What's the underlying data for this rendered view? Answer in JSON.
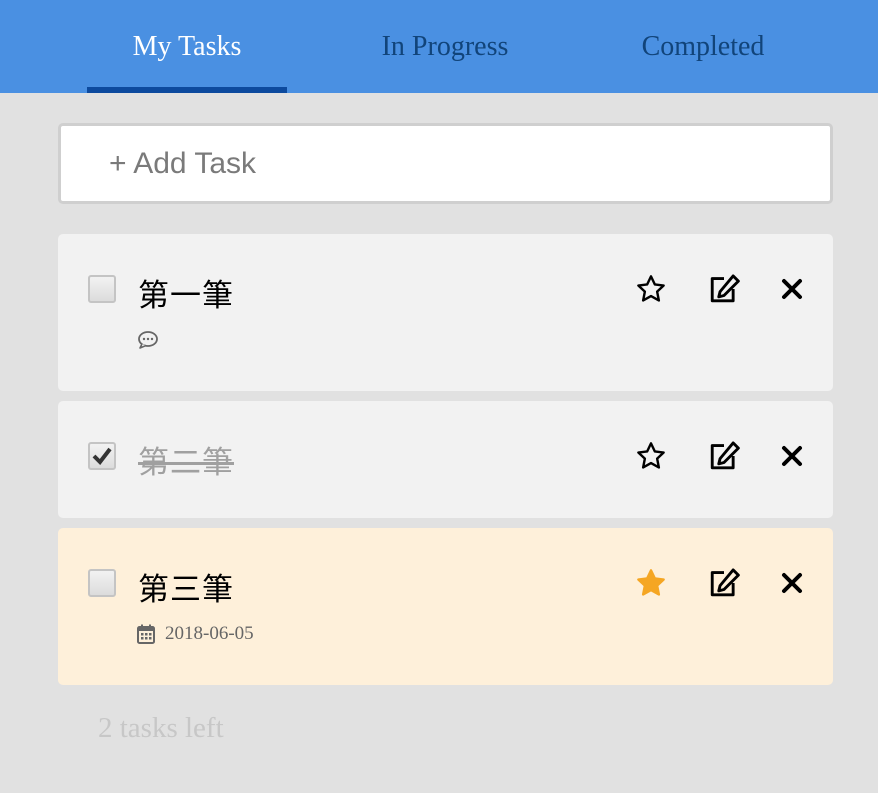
{
  "tabs": [
    {
      "label": "My Tasks",
      "active": true
    },
    {
      "label": "In Progress",
      "active": false
    },
    {
      "label": "Completed",
      "active": false
    }
  ],
  "add_task": {
    "placeholder": "+ Add Task",
    "value": ""
  },
  "tasks": [
    {
      "title": "第一筆",
      "completed": false,
      "starred": false,
      "meta": {
        "icon": "comment-icon",
        "text": ""
      }
    },
    {
      "title": "第二筆",
      "completed": true,
      "starred": false
    },
    {
      "title": "第三筆",
      "completed": false,
      "starred": true,
      "meta": {
        "icon": "calendar-icon",
        "text": "2018-06-05"
      }
    }
  ],
  "footer": {
    "tasks_left": "2 tasks left"
  },
  "colors": {
    "header": "#4a90e2",
    "tab_underline": "#0d4a9e",
    "star_active": "#f5a623",
    "important_card": "#fef0da"
  }
}
